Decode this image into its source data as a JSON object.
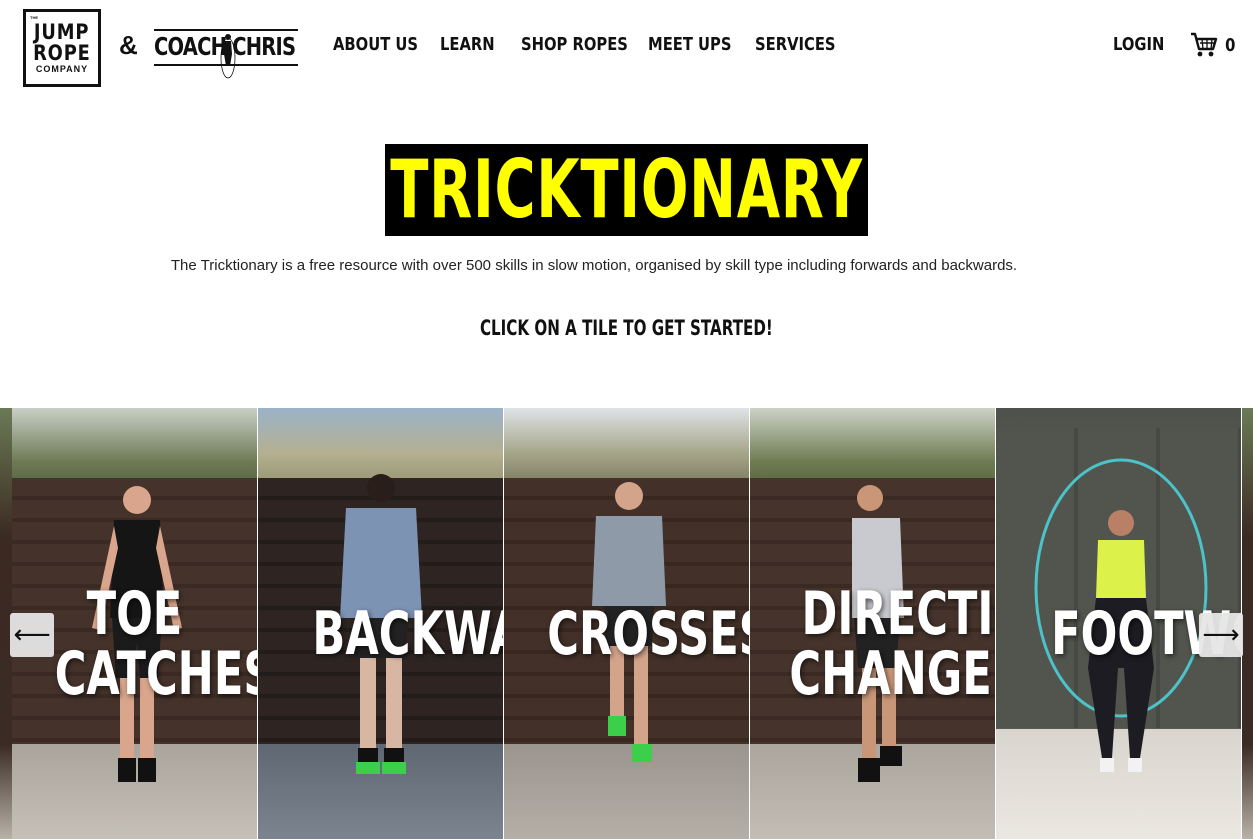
{
  "brand": {
    "jrc_the": "THE",
    "jrc_line1": "JUMP",
    "jrc_line2": "ROPE",
    "jrc_line3": "COMPANY",
    "ampersand": "&",
    "coach": "COACH CHRIS"
  },
  "nav": {
    "items": [
      {
        "label": "ABOUT US"
      },
      {
        "label": "LEARN"
      },
      {
        "label": "SHOP ROPES"
      },
      {
        "label": "MEET UPS"
      },
      {
        "label": "SERVICES"
      }
    ],
    "login": "LOGIN",
    "cart_count": "0"
  },
  "page": {
    "title": "TRICKTIONARY",
    "description": "The Tricktionary is a free resource with over 500 skills in slow motion, organised by skill type including forwards and backwards.",
    "cta": "CLICK ON A TILE TO GET STARTED!"
  },
  "carousel": {
    "tiles": [
      {
        "line1": "TOE",
        "line2": "CATCHES"
      },
      {
        "line1": "BACKWARD",
        "line2": ""
      },
      {
        "line1": "CROSSES",
        "line2": ""
      },
      {
        "line1": "DIRECTION",
        "line2": "CHANGE"
      },
      {
        "line1": "FOOTWORK",
        "line2": ""
      }
    ],
    "prev": "⟵",
    "next": "⟶"
  },
  "icons": {
    "cart": "cart-icon",
    "prev": "arrow-left-icon",
    "next": "arrow-right-icon"
  },
  "colors": {
    "title_bg": "#000000",
    "title_text": "#ffff00"
  }
}
